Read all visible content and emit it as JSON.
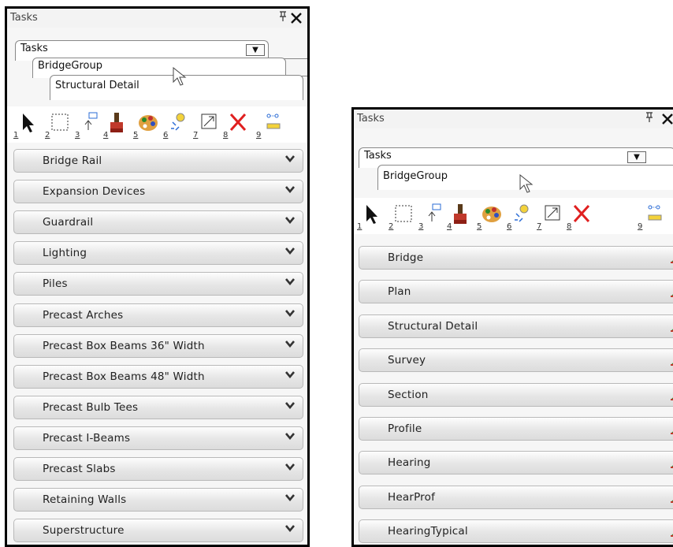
{
  "left_panel": {
    "title": "Tasks",
    "pin": "ꟸ",
    "close": "✕",
    "crumbs": [
      "Tasks",
      "BridgeGroup",
      "Structural Detail"
    ],
    "tools": [
      "1",
      "2",
      "3",
      "4",
      "5",
      "6",
      "7",
      "8",
      "9"
    ],
    "items": [
      "Bridge Rail",
      "Expansion Devices",
      "Guardrail",
      "Lighting",
      "Piles",
      "Precast Arches",
      "Precast Box Beams 36\" Width",
      "Precast Box Beams 48\" Width",
      "Precast Bulb Tees",
      "Precast I-Beams",
      "Precast Slabs",
      "Retaining Walls",
      "Superstructure"
    ]
  },
  "right_panel": {
    "title": "Tasks",
    "pin": "ꟸ",
    "close": "✕",
    "crumbs": [
      "Tasks",
      "BridgeGroup"
    ],
    "tools": [
      "1",
      "2",
      "3",
      "4",
      "5",
      "6",
      "7",
      "8",
      "9"
    ],
    "items": [
      "Bridge",
      "Plan",
      "Structural Detail",
      "Survey",
      "Section",
      "Profile",
      "Hearing",
      "HearProf",
      "HearingTypical"
    ]
  },
  "icons": {
    "dropdown": "chevron-down-icon",
    "left_item_icon": "chevron-down-icon",
    "right_item_icon": "terrain-icon"
  }
}
